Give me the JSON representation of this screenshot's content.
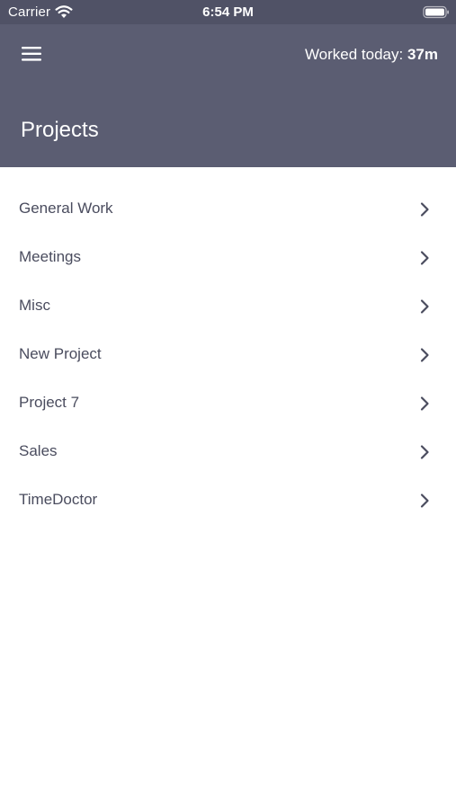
{
  "status_bar": {
    "carrier": "Carrier",
    "time": "6:54 PM",
    "icons": [
      "wifi-icon",
      "battery-icon"
    ]
  },
  "header": {
    "menu_icon": "hamburger-menu-icon",
    "worked_today_label": "Worked today:",
    "worked_today_value": "37m",
    "title": "Projects"
  },
  "projects": [
    {
      "label": "General Work"
    },
    {
      "label": "Meetings"
    },
    {
      "label": "Misc"
    },
    {
      "label": "New Project"
    },
    {
      "label": "Project 7"
    },
    {
      "label": "Sales"
    },
    {
      "label": "TimeDoctor"
    }
  ],
  "colors": {
    "header_background": "#5b5d72",
    "status_bar_background": "#505266",
    "list_text": "#4a4c5e",
    "background": "#ffffff"
  }
}
